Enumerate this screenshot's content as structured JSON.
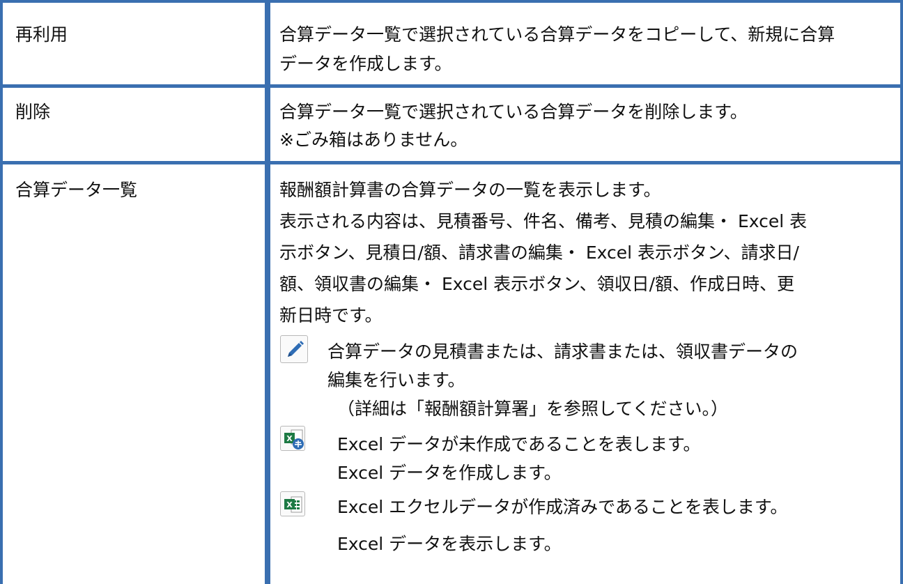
{
  "rows": [
    {
      "term": "再利用",
      "lines": [
        "合算データ一覧で選択されている合算データをコピーして、新規に合算",
        "データを作成します。"
      ]
    },
    {
      "term": "削除",
      "lines": [
        "合算データ一覧で選択されている合算データを削除します。",
        "※ごみ箱はありません。"
      ]
    },
    {
      "term": "合算データ一覧",
      "lines": [
        "報酬額計算書の合算データの一覧を表示します。",
        "表示される内容は、見積番号、件名、備考、見積の編集・ Excel 表",
        "示ボタン、見積日/額、請求書の編集・ Excel 表示ボタン、請求日/",
        "額、領収書の編集・ Excel 表示ボタン、領収日/額、作成日時、更",
        "新日時です。"
      ],
      "icons": [
        {
          "icon": "pencil-edit-icon",
          "lines": [
            "合算データの見積書または、請求書または、領収書データの",
            "編集を行います。",
            "（詳細は「報酬額計算署」を参照してください。）"
          ]
        },
        {
          "icon": "excel-not-created-icon",
          "lines": [
            "Excel データが未作成であることを表します。",
            "Excel データを作成します。"
          ]
        },
        {
          "icon": "excel-created-icon",
          "lines": [
            "Excel エクセルデータが作成済みであることを表します。",
            "Excel データを表示します。"
          ]
        }
      ]
    }
  ],
  "colors": {
    "border": "#3a6fb0",
    "excel_green": "#1d7a44",
    "badge_blue": "#2f6db5",
    "pencil": "#2f6db5"
  }
}
